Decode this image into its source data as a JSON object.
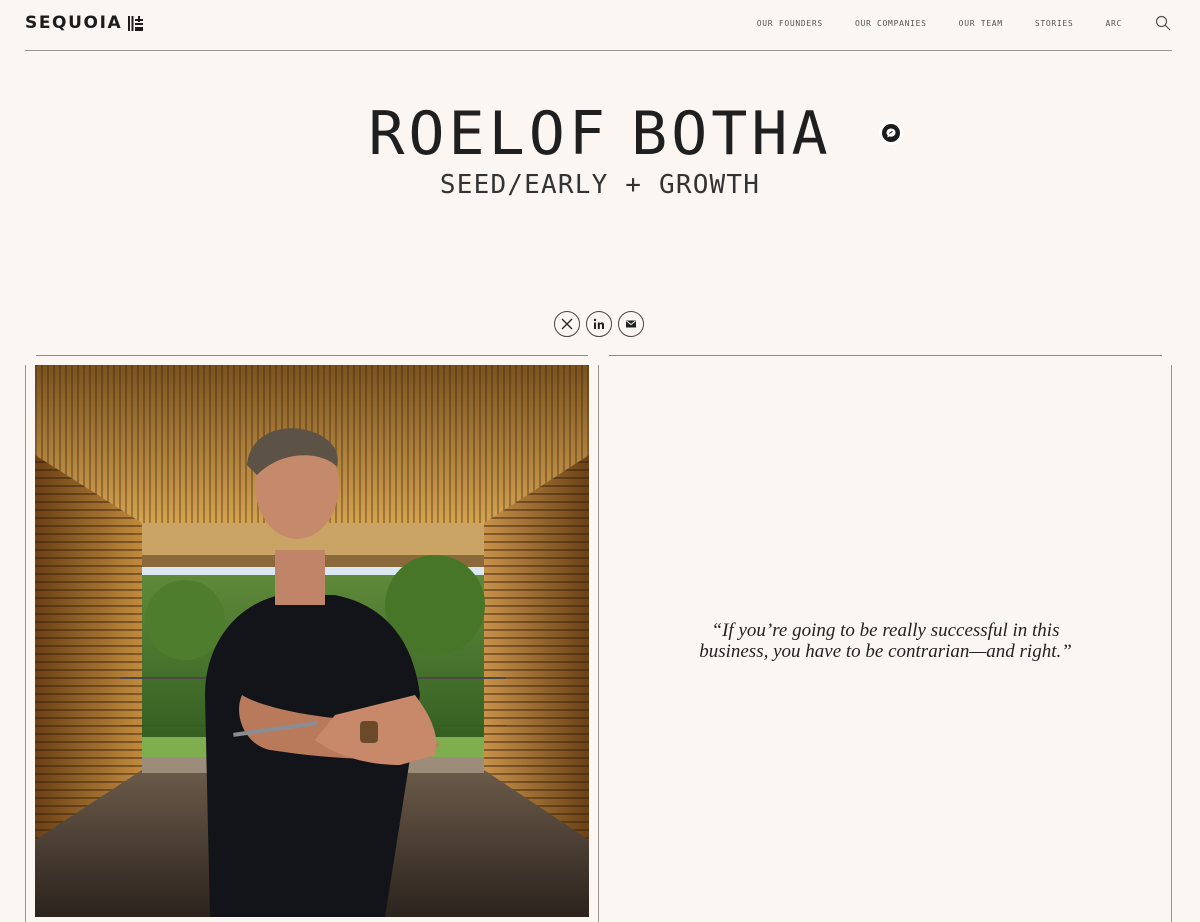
{
  "header": {
    "logo_text": "SEQUOIA",
    "nav": [
      "OUR FOUNDERS",
      "OUR COMPANIES",
      "OUR TEAM",
      "STORIES",
      "ARC"
    ],
    "search_icon": "search-icon"
  },
  "profile": {
    "first_name": "ROELOF",
    "last_name": "BOTHA",
    "subtitle": "SEED/EARLY + GROWTH",
    "socials": [
      "x-icon",
      "linkedin-icon",
      "mail-icon"
    ],
    "photo_alt": "Portrait photo",
    "quote": "“If you’re going to be really successful in this business, you have to be contrarian—and right.”"
  },
  "colors": {
    "background": "#fbf6f1",
    "text": "#1e1e1e",
    "rule": "#9a9590"
  }
}
